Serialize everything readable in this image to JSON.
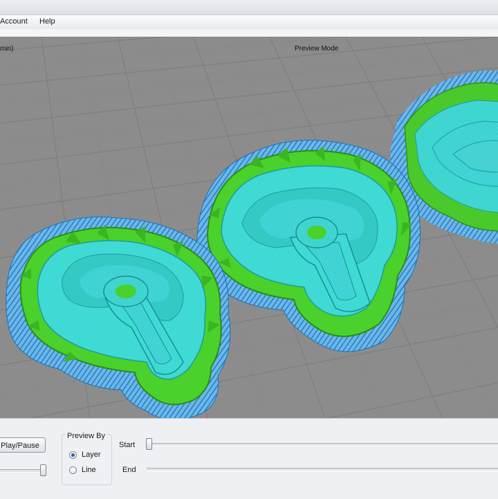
{
  "menu": {
    "items": [
      {
        "label": "Account"
      },
      {
        "label": "Help"
      }
    ]
  },
  "viewport": {
    "left_label": "min)",
    "mode_label": "Preview Mode"
  },
  "controls": {
    "play_label": "Play/Pause",
    "speed_slider_value": 0.92,
    "preview_by": {
      "title": "Preview By",
      "options": [
        {
          "label": "Layer",
          "selected": true
        },
        {
          "label": "Line",
          "selected": false
        }
      ]
    },
    "start": {
      "label": "Start",
      "value": 0.0
    },
    "end": {
      "label": "End"
    }
  },
  "colors": {
    "bed": "#8c8c8c",
    "grid": "#7a7a7a",
    "support": "#2f8fd4",
    "shell": "#4fd32a",
    "infill": "#3fd4d4"
  }
}
